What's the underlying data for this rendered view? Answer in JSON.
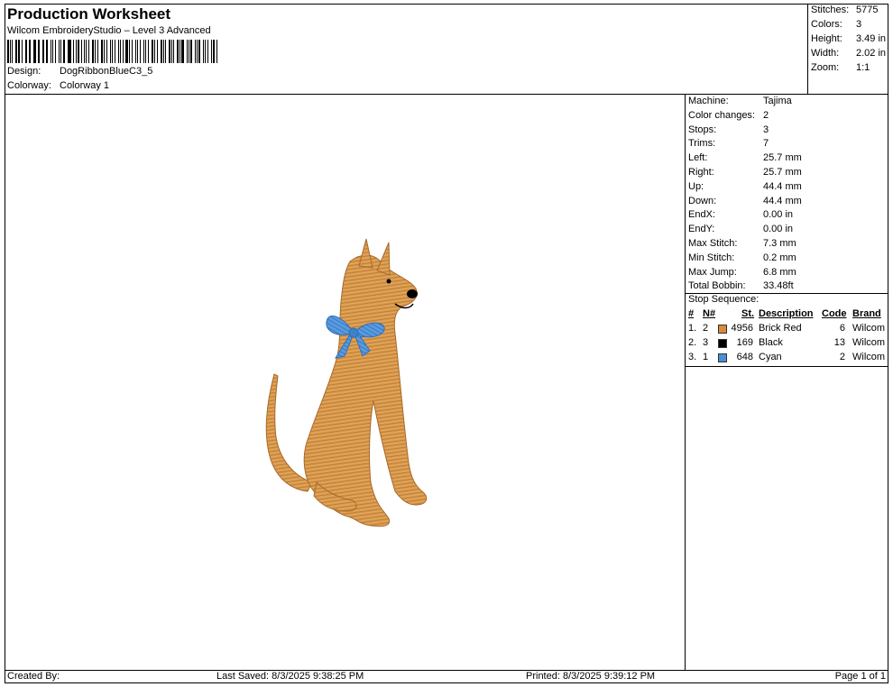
{
  "header": {
    "title": "Production Worksheet",
    "subtitle": "Wilcom EmbroideryStudio – Level 3 Advanced",
    "design_label": "Design:",
    "design_value": "DogRibbonBlueC3_5",
    "colorway_label": "Colorway:",
    "colorway_value": "Colorway 1"
  },
  "summary": [
    {
      "label": "Stitches:",
      "value": "5775"
    },
    {
      "label": "Colors:",
      "value": "3"
    },
    {
      "label": "Height:",
      "value": "3.49 in"
    },
    {
      "label": "Width:",
      "value": "2.02 in"
    },
    {
      "label": "Zoom:",
      "value": "1:1"
    }
  ],
  "machine_info": [
    {
      "label": "Machine:",
      "value": "Tajima"
    },
    {
      "label": "Color changes:",
      "value": "2"
    },
    {
      "label": "Stops:",
      "value": "3"
    },
    {
      "label": "Trims:",
      "value": "7"
    },
    {
      "label": "Left:",
      "value": "25.7 mm"
    },
    {
      "label": "Right:",
      "value": "25.7 mm"
    },
    {
      "label": "Up:",
      "value": "44.4 mm"
    },
    {
      "label": "Down:",
      "value": "44.4 mm"
    },
    {
      "label": "EndX:",
      "value": "0.00 in"
    },
    {
      "label": "EndY:",
      "value": "0.00 in"
    },
    {
      "label": "Max Stitch:",
      "value": "7.3 mm"
    },
    {
      "label": "Min Stitch:",
      "value": "0.2 mm"
    },
    {
      "label": "Max Jump:",
      "value": "6.8 mm"
    },
    {
      "label": "Total Bobbin:",
      "value": "33.48ft"
    }
  ],
  "stop_sequence": {
    "title": "Stop Sequence:",
    "headers": {
      "num": "#",
      "n": "N#",
      "st": "St.",
      "desc": "Description",
      "code": "Code",
      "brand": "Brand"
    },
    "rows": [
      {
        "num": "1.",
        "n": "2",
        "color": "#d98a3c",
        "st": "4956",
        "desc": "Brick Red",
        "code": "6",
        "brand": "Wilcom"
      },
      {
        "num": "2.",
        "n": "3",
        "color": "#000000",
        "st": "169",
        "desc": "Black",
        "code": "13",
        "brand": "Wilcom"
      },
      {
        "num": "3.",
        "n": "1",
        "color": "#4a8fd6",
        "st": "648",
        "desc": "Cyan",
        "code": "2",
        "brand": "Wilcom"
      }
    ]
  },
  "footer": {
    "created_by": "Created By:",
    "last_saved": "Last Saved: 8/3/2025 9:38:25 PM",
    "printed": "Printed: 8/3/2025 9:39:12 PM",
    "page": "Page 1 of 1"
  },
  "design_preview": {
    "thread_colors": {
      "body": "#d99a4e",
      "ribbon": "#4a8fd6",
      "outline": "#000000"
    }
  }
}
